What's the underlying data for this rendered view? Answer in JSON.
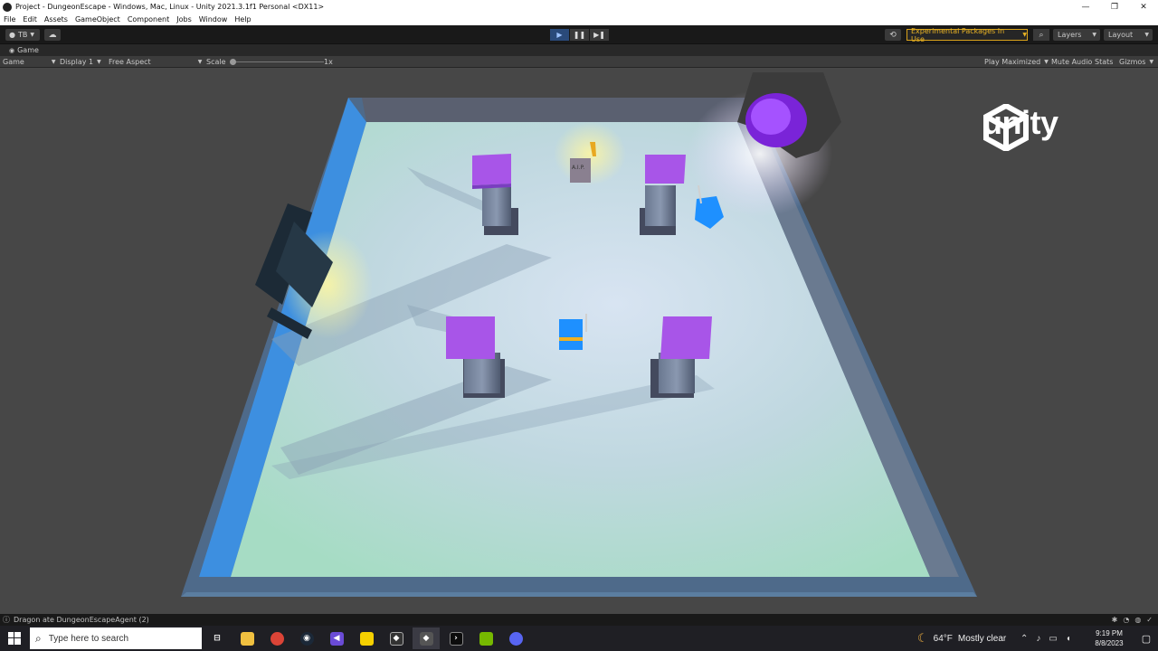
{
  "window": {
    "title": "Project - DungeonEscape - Windows, Mac, Linux - Unity 2021.3.1f1 Personal <DX11>",
    "controls": [
      "—",
      "❐",
      "✕"
    ]
  },
  "menu": [
    "File",
    "Edit",
    "Assets",
    "GameObject",
    "Component",
    "Jobs",
    "Window",
    "Help"
  ],
  "toolbar": {
    "account_label": "TB",
    "experimental_label": "Experimental Packages In Use",
    "layers_label": "Layers",
    "layout_label": "Layout"
  },
  "game_tab": {
    "label": "Game",
    "mode": "Game",
    "display": "Display 1",
    "aspect": "Free Aspect",
    "scale_label": "Scale",
    "scale_value": "1x",
    "play_maximized": "Play Maximized",
    "mute_audio": "Mute Audio",
    "stats": "Stats",
    "gizmos": "Gizmos"
  },
  "overlay": {
    "logo_text": "unity",
    "sign_text": "A.I.P."
  },
  "status": {
    "message": "Dragon ate DungeonEscapeAgent (2)"
  },
  "taskbar": {
    "search_placeholder": "Type here to search",
    "weather_temp": "64°F",
    "weather_text": "Mostly clear",
    "time": "9:19 PM",
    "date": "8/8/2023"
  },
  "colors": {
    "accent_play": "#2a4a7a",
    "experimental": "#e9b325",
    "pillar_top": "#a855e8",
    "agent_blue": "#1e90ff",
    "portal_purple": "#8a2be2"
  }
}
